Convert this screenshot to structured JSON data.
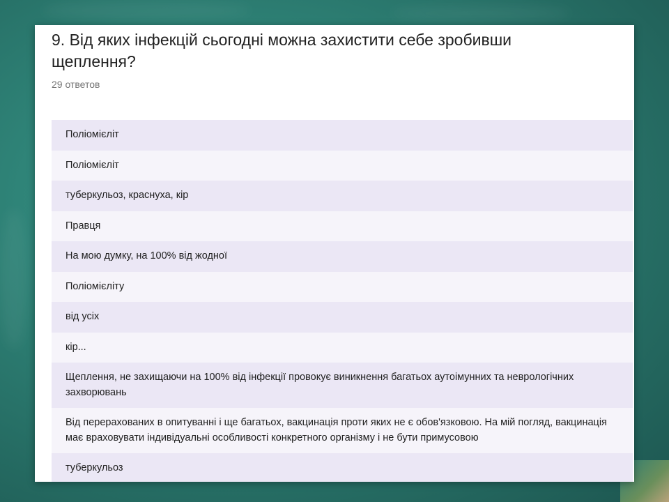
{
  "question": {
    "title": "9. Від яких інфекцій сьогодні можна захистити себе зробивши щеплення?",
    "response_count": "29 ответов"
  },
  "answers": [
    "Поліомієліт",
    "Поліомієліт",
    "туберкульоз, краснуха, кір",
    "Правця",
    "На мою думку, на 100% від жодної",
    "Поліомієліту",
    "від усіх",
    "кір...",
    "Щеплення, не захищаючи на 100% від інфекції провокує виникнення багатьох аутоімунних та неврологічних захворювань",
    "Від перерахованих в опитуванні і ще багатьох, вакцинація проти яких не є обов'язковою. На мій погляд, вакцинація має враховувати індивідуальні особливості конкретного організму і не бути примусовою",
    "туберкульоз"
  ],
  "colors": {
    "background": "#2f8478",
    "row_odd": "#ebe7f5",
    "row_even": "#f6f4fa"
  }
}
